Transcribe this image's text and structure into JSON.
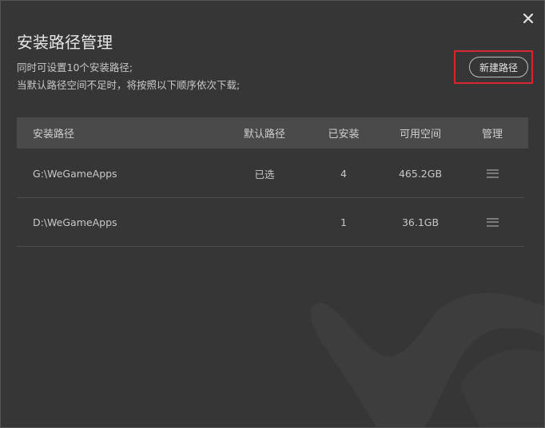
{
  "dialog": {
    "title": "安装路径管理",
    "description_line1": "同时可设置10个安装路径;",
    "description_line2": "当默认路径空间不足时，将按照以下顺序依次下载;",
    "new_path_label": "新建路径",
    "close_icon": "close-icon"
  },
  "table": {
    "headers": {
      "path": "安装路径",
      "default": "默认路径",
      "installed": "已安装",
      "space": "可用空间",
      "manage": "管理"
    },
    "rows": [
      {
        "path": "G:\\WeGameApps",
        "default": "已选",
        "installed": "4",
        "space": "465.2GB",
        "manage_icon": "menu-icon"
      },
      {
        "path": "D:\\WeGameApps",
        "default": "",
        "installed": "1",
        "space": "36.1GB",
        "manage_icon": "menu-icon"
      }
    ]
  },
  "colors": {
    "background": "#363636",
    "header_row": "#4a4a4a",
    "highlight": "#d8262c"
  }
}
